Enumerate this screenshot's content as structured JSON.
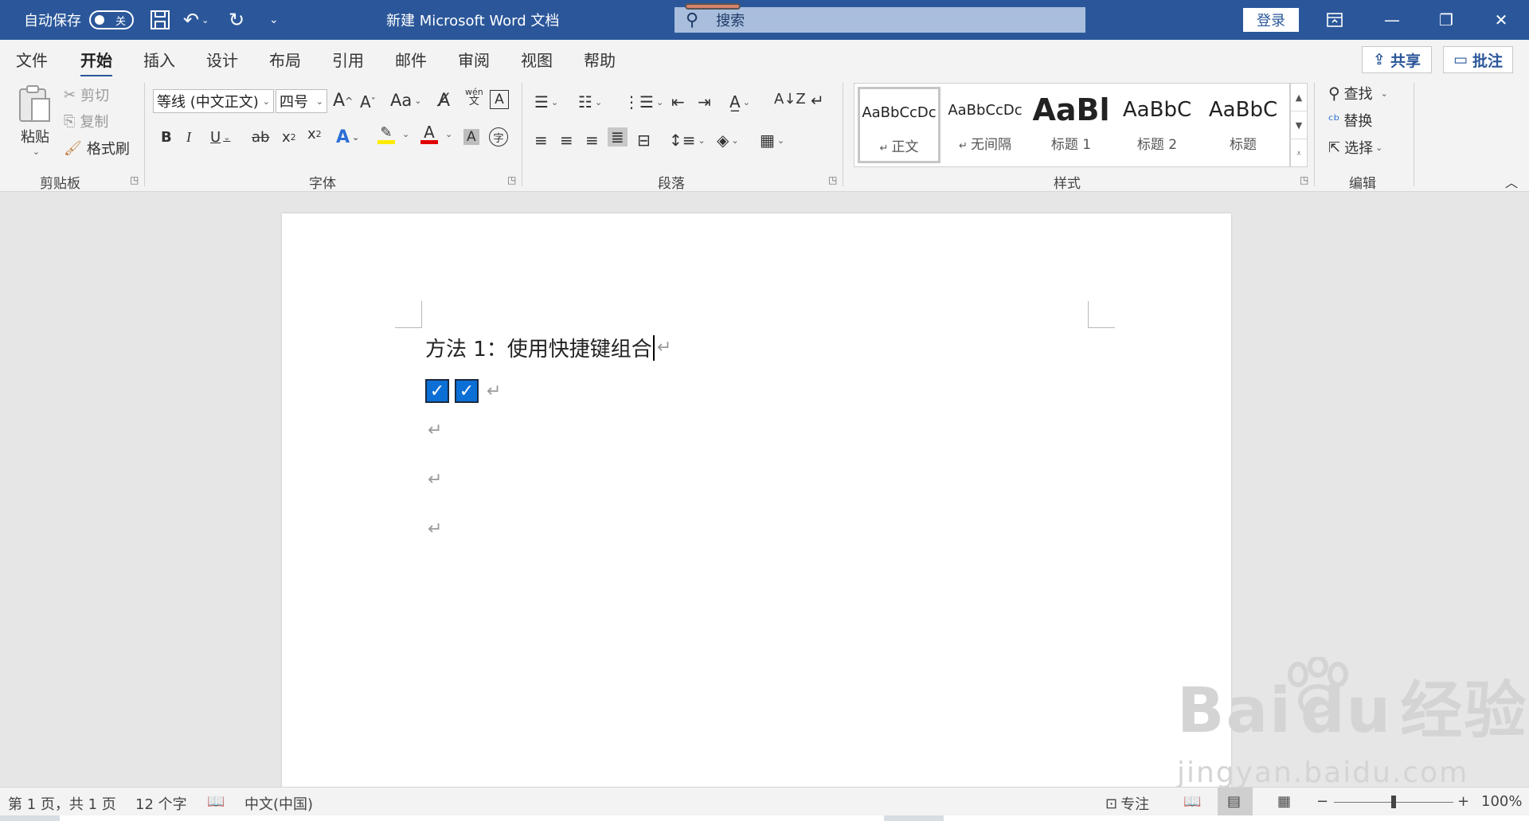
{
  "titlebar": {
    "autosave_label": "自动保存",
    "autosave_state": "关",
    "doc_title": "新建 Microsoft Word 文档",
    "search_placeholder": "搜索",
    "login_label": "登录"
  },
  "tabs": [
    "文件",
    "开始",
    "插入",
    "设计",
    "布局",
    "引用",
    "邮件",
    "审阅",
    "视图",
    "帮助"
  ],
  "active_tab": "开始",
  "share_label": "共享",
  "comment_label": "批注",
  "clipboard": {
    "paste_label": "粘贴",
    "cut_label": "剪切",
    "copy_label": "复制",
    "format_painter_label": "格式刷",
    "group_label": "剪贴板"
  },
  "font": {
    "font_name": "等线 (中文正文)",
    "font_size": "四号",
    "group_label": "字体",
    "pinyin_top": "wén",
    "pinyin_bottom": "文"
  },
  "paragraph": {
    "group_label": "段落"
  },
  "styles": {
    "group_label": "样式",
    "items": [
      {
        "preview": "AaBbCcDc",
        "name": "正文"
      },
      {
        "preview": "AaBbCcDc",
        "name": "无间隔"
      },
      {
        "preview": "AaBl",
        "name": "标题 1"
      },
      {
        "preview": "AaBbC",
        "name": "标题 2"
      },
      {
        "preview": "AaBbC",
        "name": "标题"
      }
    ]
  },
  "editing": {
    "find_label": "查找",
    "replace_label": "替换",
    "select_label": "选择",
    "group_label": "编辑"
  },
  "document": {
    "heading": "方法 1：使用快捷键组合",
    "para_mark": "↵",
    "checkbox_count": 2
  },
  "watermark": {
    "main": "Bai",
    "du": "du",
    "cn": "经验",
    "sub": "jingyan.baidu.com"
  },
  "status": {
    "page_info": "第 1 页，共 1 页",
    "word_count": "12 个字",
    "language": "中文(中国)",
    "focus_label": "专注",
    "zoom_level": "100%",
    "zoom_fraction": 0.5
  },
  "colors": {
    "titlebar": "#2b579a",
    "checkbox": "#0b6fd6",
    "highlight": "#ffeb00",
    "font_color": "#e00000"
  }
}
